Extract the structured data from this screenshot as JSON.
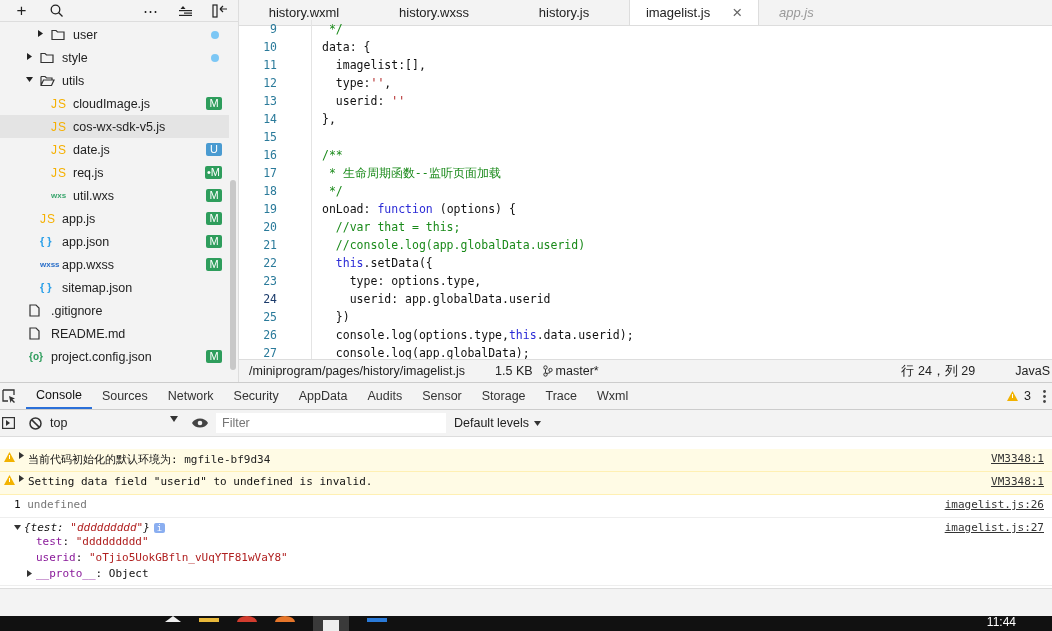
{
  "sidebar": {
    "toolbar": [
      "+",
      "⋯"
    ],
    "tree": [
      {
        "children": [
          {
            "children": [
              {
                "label": "user",
                "kind": "folder",
                "expanded": false,
                "selected": false,
                "dot": {
                  "color": "#7cc7f5"
                }
              }
            ]
          },
          {
            "label": "style",
            "kind": "folder",
            "expanded": false,
            "selected": false,
            "dot": {
              "color": "#7cc7f5"
            }
          },
          {
            "label": "utils",
            "kind": "folder",
            "expanded": true,
            "selected": false,
            "children": [
              {
                "label": "cloudImage.js",
                "kind": "js",
                "icon": "JS",
                "selected": false,
                "badge": {
                  "text": "M",
                  "color": "#2e9d5c"
                }
              },
              {
                "label": "cos-wx-sdk-v5.js",
                "kind": "js",
                "icon": "JS",
                "selected": true
              },
              {
                "label": "date.js",
                "kind": "js",
                "icon": "JS",
                "selected": false,
                "badge": {
                  "text": "U",
                  "color": "#4a9bd1"
                }
              },
              {
                "label": "req.js",
                "kind": "js",
                "icon": "JS",
                "selected": false,
                "badge": {
                  "text": "•M",
                  "color": "#2e9d5c"
                }
              },
              {
                "label": "util.wxs",
                "kind": "wxs",
                "icon": "wxs",
                "selected": false,
                "badge": {
                  "text": "M",
                  "color": "#2e9d5c"
                }
              }
            ]
          },
          {
            "label": "app.js",
            "kind": "js",
            "icon": "JS",
            "selected": false,
            "badge": {
              "text": "M",
              "color": "#2e9d5c"
            }
          },
          {
            "label": "app.json",
            "kind": "json",
            "icon": "{ }",
            "selected": false,
            "badge": {
              "text": "M",
              "color": "#2e9d5c"
            }
          },
          {
            "label": "app.wxss",
            "kind": "wxss",
            "icon": "wxss",
            "selected": false,
            "badge": {
              "text": "M",
              "color": "#2e9d5c"
            }
          },
          {
            "label": "sitemap.json",
            "kind": "json",
            "icon": "{ }",
            "selected": false
          }
        ]
      },
      {
        "label": ".gitignore",
        "kind": "file",
        "selected": false
      },
      {
        "label": "README.md",
        "kind": "file",
        "selected": false
      },
      {
        "label": "project.config.json",
        "kind": "config",
        "icon": "{o}",
        "selected": false,
        "badge": {
          "text": "M",
          "color": "#2e9d5c"
        }
      }
    ]
  },
  "editor": {
    "tabs": [
      {
        "label": "history.wxml",
        "selected": false,
        "preview": false
      },
      {
        "label": "history.wxss",
        "selected": false,
        "preview": false
      },
      {
        "label": "history.js",
        "selected": false,
        "preview": false
      },
      {
        "label": "imagelist.js",
        "selected": true,
        "preview": false,
        "close": "×"
      },
      {
        "label": "app.js",
        "selected": false,
        "preview": true
      }
    ],
    "lines": [
      {
        "number": "9",
        "current": false,
        "segments": [
          {
            "kind": "comment",
            "text": " */"
          }
        ]
      },
      {
        "number": "10",
        "current": false,
        "segments": [
          {
            "kind": "plain",
            "text": "data: {"
          }
        ]
      },
      {
        "number": "11",
        "current": false,
        "segments": [
          {
            "kind": "plain",
            "text": "  imagelist:[],"
          }
        ]
      },
      {
        "number": "12",
        "current": false,
        "segments": [
          {
            "kind": "plain",
            "text": "  type:"
          },
          {
            "kind": "string",
            "text": "''"
          },
          {
            "kind": "plain",
            "text": ","
          }
        ]
      },
      {
        "number": "13",
        "current": false,
        "segments": [
          {
            "kind": "plain",
            "text": "  userid: "
          },
          {
            "kind": "string",
            "text": "''"
          }
        ]
      },
      {
        "number": "14",
        "current": false,
        "segments": [
          {
            "kind": "plain",
            "text": "},"
          }
        ]
      },
      {
        "number": "15",
        "current": false
      },
      {
        "number": "16",
        "current": false,
        "segments": [
          {
            "kind": "comment",
            "text": "/**"
          }
        ]
      },
      {
        "number": "17",
        "current": false,
        "segments": [
          {
            "kind": "comment",
            "text": " * 生命周期函数--监听页面加载"
          }
        ]
      },
      {
        "number": "18",
        "current": false,
        "segments": [
          {
            "kind": "comment",
            "text": " */"
          }
        ]
      },
      {
        "number": "19",
        "current": false,
        "segments": [
          {
            "kind": "plain",
            "text": "onLoad: "
          },
          {
            "kind": "keyword",
            "text": "function"
          },
          {
            "kind": "plain",
            "text": " (options) {"
          }
        ]
      },
      {
        "number": "20",
        "current": false,
        "segments": [
          {
            "kind": "comment",
            "text": "  //var that = this;"
          }
        ]
      },
      {
        "number": "21",
        "current": false,
        "segments": [
          {
            "kind": "comment",
            "text": "  //console.log(app.globalData.userid)"
          }
        ]
      },
      {
        "number": "22",
        "current": false,
        "segments": [
          {
            "kind": "keyword",
            "text": "  this"
          },
          {
            "kind": "plain",
            "text": ".setData({"
          }
        ]
      },
      {
        "number": "23",
        "current": false,
        "segments": [
          {
            "kind": "plain",
            "text": "    type: options.type,"
          }
        ]
      },
      {
        "number": "24",
        "current": true,
        "segments": [
          {
            "kind": "plain",
            "text": "    userid: app.globalData.userid"
          }
        ]
      },
      {
        "number": "25",
        "current": false,
        "segments": [
          {
            "kind": "plain",
            "text": "  })"
          }
        ]
      },
      {
        "number": "26",
        "current": false,
        "segments": [
          {
            "kind": "plain",
            "text": "  console.log(options.type,"
          },
          {
            "kind": "keyword",
            "text": "this"
          },
          {
            "kind": "plain",
            "text": ".data.userid);"
          }
        ]
      },
      {
        "number": "27",
        "current": false,
        "segments": [
          {
            "kind": "plain",
            "text": "  console.log(app.globalData);"
          }
        ]
      }
    ],
    "status_bar": {
      "path": "/miniprogram/pages/history/imagelist.js",
      "size": "1.5 KB",
      "branch": "master*",
      "position": "行 24，列 29",
      "language": "JavaS"
    }
  },
  "devtools": {
    "tabs": [
      {
        "label": "Console",
        "selected": true
      },
      {
        "label": "Sources",
        "selected": false
      },
      {
        "label": "Network",
        "selected": false
      },
      {
        "label": "Security",
        "selected": false
      },
      {
        "label": "AppData",
        "selected": false
      },
      {
        "label": "Audits",
        "selected": false
      },
      {
        "label": "Sensor",
        "selected": false
      },
      {
        "label": "Storage",
        "selected": false
      },
      {
        "label": "Trace",
        "selected": false
      },
      {
        "label": "Wxml",
        "selected": false
      }
    ],
    "warning_count": "3",
    "context": "top",
    "filter": {
      "placeholder": "Filter"
    },
    "levels": "Default levels",
    "messages": [
      {
        "kind": "warn",
        "segments": [
          {
            "kind": "plain",
            "text": "当前代码初始化的默认环境为: "
          },
          {
            "kind": "value",
            "text": "mgfile-bf9d34"
          }
        ],
        "source": "VM3348:1"
      },
      {
        "kind": "warn",
        "segments": [
          {
            "kind": "plain",
            "text": "Setting data field \"userid\" to undefined is invalid."
          }
        ],
        "source": "VM3348:1"
      },
      {
        "kind": "log",
        "segments": [
          {
            "kind": "plain",
            "text": "1 "
          },
          {
            "kind": "muted",
            "text": "undefined"
          }
        ],
        "source": "imagelist.js:26"
      },
      {
        "kind": "object",
        "expanded": true,
        "segments": [
          {
            "kind": "plain",
            "text": "{test: "
          },
          {
            "kind": "string",
            "text": "\"ddddddddd\""
          },
          {
            "kind": "plain",
            "text": "}"
          }
        ],
        "info": "i",
        "source": "imagelist.js:27",
        "properties": [
          {
            "segments": [
              {
                "kind": "key",
                "text": "test"
              },
              {
                "kind": "plain",
                "text": ": "
              },
              {
                "kind": "string",
                "text": "\"ddddddddd\""
              }
            ]
          },
          {
            "segments": [
              {
                "kind": "key",
                "text": "userid"
              },
              {
                "kind": "plain",
                "text": ": "
              },
              {
                "kind": "string",
                "text": "\"oTjio5UokGBfln_vUqYTF81wVaY8\""
              }
            ]
          },
          {
            "expandable": true,
            "segments": [
              {
                "kind": "proto",
                "text": "__proto__"
              },
              {
                "kind": "plain",
                "text": ": Object"
              }
            ]
          }
        ]
      }
    ]
  },
  "taskbar": {
    "clock": "11:44"
  }
}
